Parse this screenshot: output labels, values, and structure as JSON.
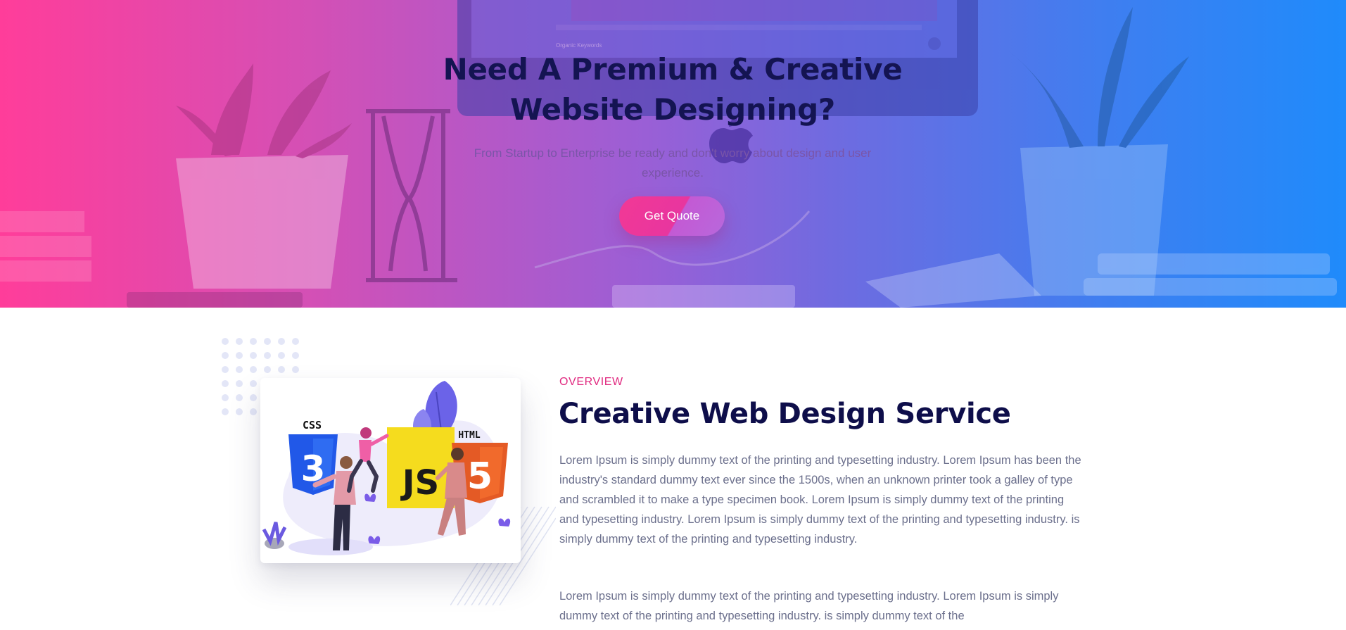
{
  "hero": {
    "title_line1": "Need A Premium & Creative",
    "title_line2": "Website Designing?",
    "subtitle_line1": "From Startup to Enterprise be ready and don't worry about design and user",
    "subtitle_line2": "experience.",
    "cta_label": "Get Quote",
    "monitor_label": "Organic Keywords"
  },
  "overview": {
    "eyebrow": "OVERVIEW",
    "title": "Creative Web Design Service",
    "paragraph1": "Lorem Ipsum is simply dummy text of the printing and typesetting industry. Lorem Ipsum has been the industry's standard dummy text ever since the 1500s, when an unknown printer took a galley of type and scrambled it to make a type specimen book. Lorem Ipsum is simply dummy text of the printing and typesetting industry. Lorem Ipsum is simply dummy text of the printing and typesetting industry. is simply dummy text of the printing and typesetting industry.",
    "paragraph2": "Lorem Ipsum is simply dummy text of the printing and typesetting industry. Lorem Ipsum is simply dummy text of the printing and typesetting industry. is simply dummy text of the"
  },
  "illustration": {
    "css_label": "CSS",
    "js_label": "JS",
    "html_label": "HTML",
    "css_digit": "3",
    "html_digit": "5"
  },
  "colors": {
    "gradient_start": "#ff3d9a",
    "gradient_end": "#1f8bfb",
    "accent_pink": "#e0287f",
    "heading_navy": "#0e0e4a",
    "body_text": "#6b6f8c"
  }
}
